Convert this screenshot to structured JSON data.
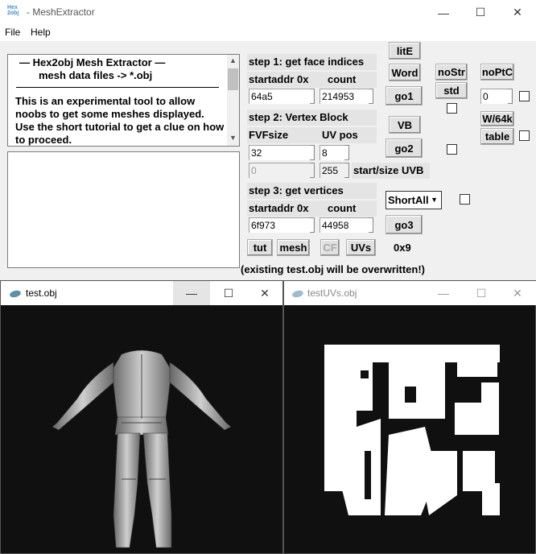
{
  "main_window": {
    "title": "- MeshExtractor",
    "icon_text": [
      "Hex",
      "2obj"
    ],
    "menu": [
      "File",
      "Help"
    ],
    "info": {
      "line1": "— Hex2obj Mesh Extractor —",
      "line2": "mesh data files -> *.obj",
      "desc": "This is an experimental tool to allow noobs to get some meshes displayed. Use the short tutorial to get a clue on how to proceed."
    },
    "step1": {
      "label": "step 1: get face indices",
      "addr_label": "startaddr 0x",
      "count_label": "count",
      "addr_value": "64a5",
      "count_value": "214953"
    },
    "step2": {
      "label": "step 2: Vertex Block",
      "fvf_label": "FVFsize",
      "uvpos_label": "UV pos",
      "fvf_value": "32",
      "uvpos_value": "8",
      "start_value": "0",
      "size_value": "255",
      "start_size_label": "start/size UVB"
    },
    "step3": {
      "label": "step 3: get vertices",
      "addr_label": "startaddr 0x",
      "count_label": "count",
      "addr_value": "6f973",
      "count_value": "44958",
      "dropdown_value": "ShortAll"
    },
    "buttons": {
      "lite": "litE",
      "word": "Word",
      "go1": "go1",
      "vb": "VB",
      "go2": "go2",
      "go3": "go3",
      "nostr": "noStr",
      "std": "std",
      "noptc": "noPtC",
      "w64k": "W/64k",
      "table": "table",
      "tut": "tut",
      "mesh": "mesh",
      "cf": "CF",
      "uvs": "UVs"
    },
    "right_field_value": "0",
    "hex_label": "0x9",
    "warning": "(existing test.obj will be overwritten!)"
  },
  "window_test": {
    "title": "test.obj"
  },
  "window_uvs": {
    "title": "testUVs.obj"
  }
}
